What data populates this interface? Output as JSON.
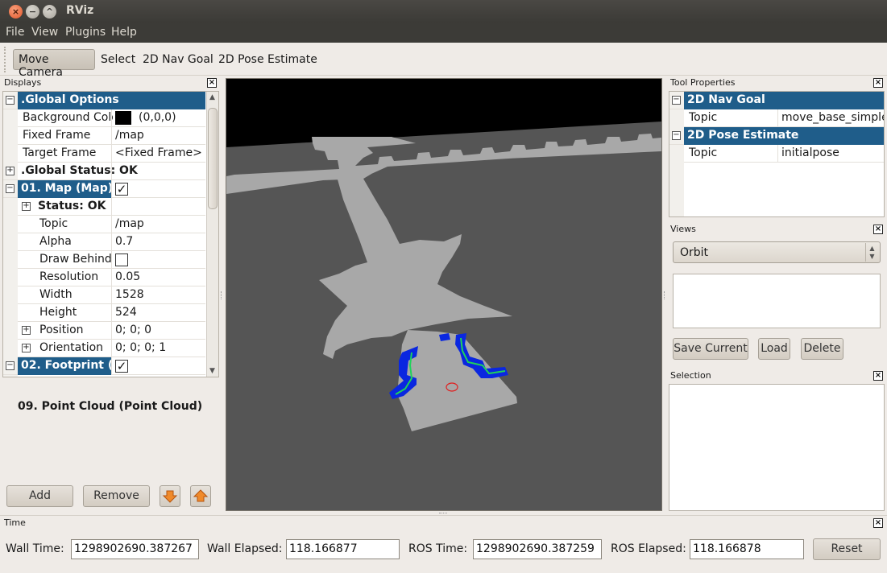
{
  "window": {
    "title": "RViz"
  },
  "menu": [
    "File",
    "View",
    "Plugins",
    "Help"
  ],
  "toolbar": {
    "tools": [
      "Move Camera",
      "Select",
      "2D Nav Goal",
      "2D Pose Estimate"
    ],
    "active": "Move Camera"
  },
  "displays": {
    "title": "Displays",
    "rows": [
      {
        "name": ".Global Options",
        "type": "header"
      },
      {
        "name": "Background Colo",
        "value": "(0,0,0)",
        "swatch": "#000000"
      },
      {
        "name": "Fixed Frame",
        "value": "/map"
      },
      {
        "name": "Target Frame",
        "value": "<Fixed Frame>"
      },
      {
        "name": ".Global Status: OK",
        "type": "group"
      },
      {
        "name": "01. Map (Map)",
        "type": "header",
        "checked": true
      },
      {
        "name": "Status: OK",
        "type": "subgroup"
      },
      {
        "name": "Topic",
        "value": "/map"
      },
      {
        "name": "Alpha",
        "value": "0.7"
      },
      {
        "name": "Draw Behind",
        "checkbox": true,
        "checked": false
      },
      {
        "name": "Resolution",
        "value": "0.05"
      },
      {
        "name": "Width",
        "value": "1528"
      },
      {
        "name": "Height",
        "value": "524"
      },
      {
        "name": "Position",
        "value": "0; 0; 0",
        "expandable": true
      },
      {
        "name": "Orientation",
        "value": "0; 0; 0; 1",
        "expandable": true
      },
      {
        "name": "02. Footprint (",
        "type": "header",
        "checked": true
      }
    ],
    "description": "09. Point Cloud (Point Cloud)",
    "buttons": {
      "add": "Add",
      "remove": "Remove"
    }
  },
  "tool_properties": {
    "title": "Tool Properties",
    "rows": [
      {
        "name": "2D Nav Goal",
        "type": "header"
      },
      {
        "name": "Topic",
        "value": "move_base_simple"
      },
      {
        "name": "2D Pose Estimate",
        "type": "header"
      },
      {
        "name": "Topic",
        "value": "initialpose"
      }
    ]
  },
  "views": {
    "title": "Views",
    "selected": "Orbit",
    "buttons": {
      "save": "Save Current",
      "load": "Load",
      "delete": "Delete"
    }
  },
  "selection": {
    "title": "Selection"
  },
  "time": {
    "title": "Time",
    "wall_time_label": "Wall Time:",
    "wall_time": "1298902690.387267",
    "wall_elapsed_label": "Wall Elapsed:",
    "wall_elapsed": "118.166877",
    "ros_time_label": "ROS Time:",
    "ros_time": "1298902690.387259",
    "ros_elapsed_label": "ROS Elapsed:",
    "ros_elapsed": "118.166878",
    "reset": "Reset"
  },
  "colors": {
    "header": "#1f5d8a",
    "viewport_bg": "#555555",
    "map_free": "#a8a8a8",
    "obstacle": "#0a27e0",
    "inflation": "#1fd35a",
    "goal": "#e02020"
  }
}
